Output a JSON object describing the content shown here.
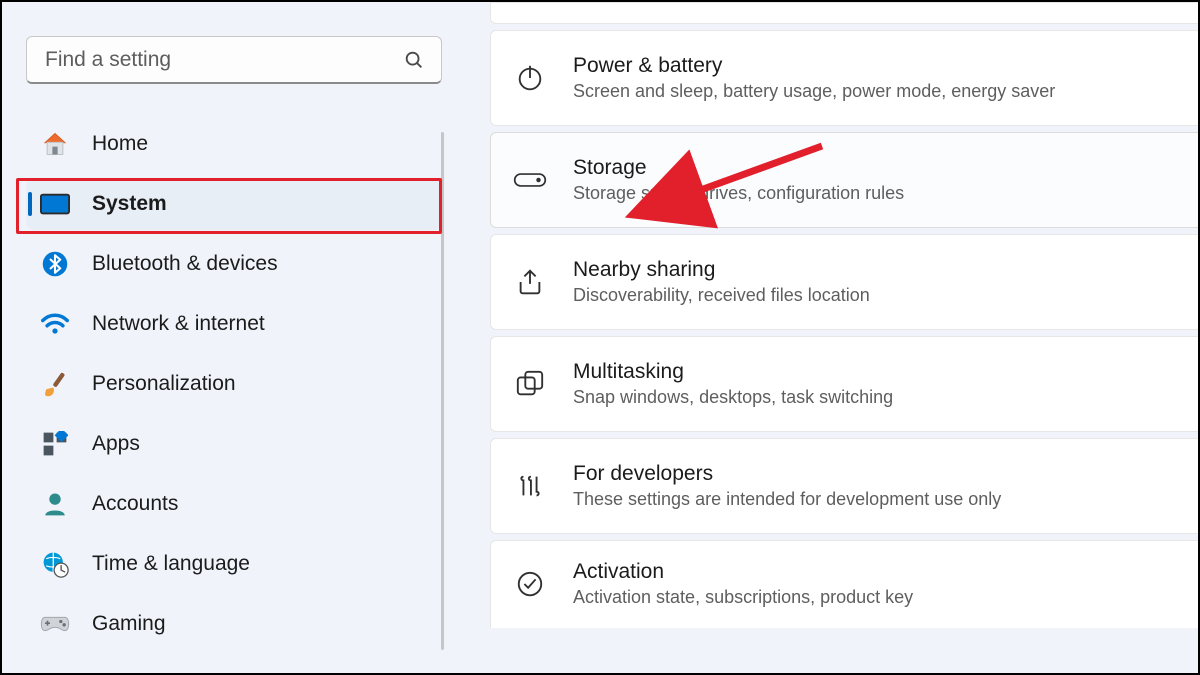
{
  "search": {
    "placeholder": "Find a setting"
  },
  "sidebar": {
    "items": [
      {
        "id": "home",
        "label": "Home",
        "icon": "home"
      },
      {
        "id": "system",
        "label": "System",
        "icon": "system"
      },
      {
        "id": "bluetooth",
        "label": "Bluetooth & devices",
        "icon": "bluetooth"
      },
      {
        "id": "network",
        "label": "Network & internet",
        "icon": "wifi"
      },
      {
        "id": "personalization",
        "label": "Personalization",
        "icon": "brush"
      },
      {
        "id": "apps",
        "label": "Apps",
        "icon": "apps"
      },
      {
        "id": "accounts",
        "label": "Accounts",
        "icon": "person"
      },
      {
        "id": "time",
        "label": "Time & language",
        "icon": "clock"
      },
      {
        "id": "gaming",
        "label": "Gaming",
        "icon": "gamepad"
      }
    ],
    "selected_index": 1
  },
  "main": {
    "cards": [
      {
        "id": "power",
        "title": "Power & battery",
        "desc": "Screen and sleep, battery usage, power mode, energy saver",
        "icon": "power"
      },
      {
        "id": "storage",
        "title": "Storage",
        "desc": "Storage space, drives, configuration rules",
        "icon": "drive"
      },
      {
        "id": "nearby",
        "title": "Nearby sharing",
        "desc": "Discoverability, received files location",
        "icon": "share"
      },
      {
        "id": "multitask",
        "title": "Multitasking",
        "desc": "Snap windows, desktops, task switching",
        "icon": "windows"
      },
      {
        "id": "developers",
        "title": "For developers",
        "desc": "These settings are intended for development use only",
        "icon": "devtools"
      },
      {
        "id": "activation",
        "title": "Activation",
        "desc": "Activation state, subscriptions, product key",
        "icon": "check"
      }
    ],
    "hover_index": 1
  },
  "annotation": {
    "highlight_sidebar_index": 1,
    "arrow_target_card_index": 1
  }
}
